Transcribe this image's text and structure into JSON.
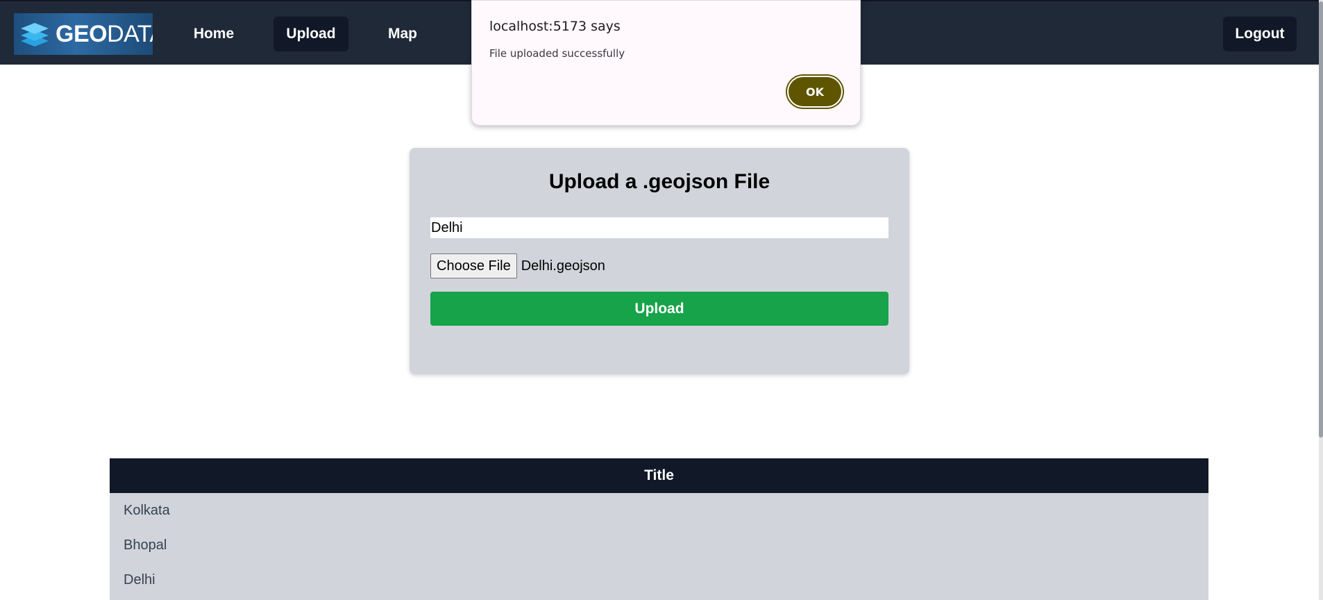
{
  "navbar": {
    "logo_bold": "GEO",
    "logo_light": "DATA",
    "items": [
      {
        "label": "Home",
        "active": false
      },
      {
        "label": "Upload",
        "active": true
      },
      {
        "label": "Map",
        "active": false
      }
    ],
    "logout_label": "Logout"
  },
  "upload_card": {
    "title": "Upload a .geojson File",
    "title_input_value": "Delhi",
    "choose_file_label": "Choose File",
    "file_name": "Delhi.geojson",
    "upload_label": "Upload"
  },
  "table": {
    "header": "Title",
    "rows": [
      "Kolkata",
      "Bhopal",
      "Delhi"
    ]
  },
  "dialog": {
    "title": "localhost:5173 says",
    "message": "File uploaded successfully",
    "ok_label": "OK"
  },
  "colors": {
    "navbar_bg": "#1f2937",
    "active_nav_bg": "#111827",
    "card_bg": "#d1d5db",
    "upload_button": "#16a34a",
    "table_header_bg": "#111827",
    "dialog_ok": "#5f5500"
  },
  "icons": {
    "logo": "stacked-layers-icon"
  }
}
